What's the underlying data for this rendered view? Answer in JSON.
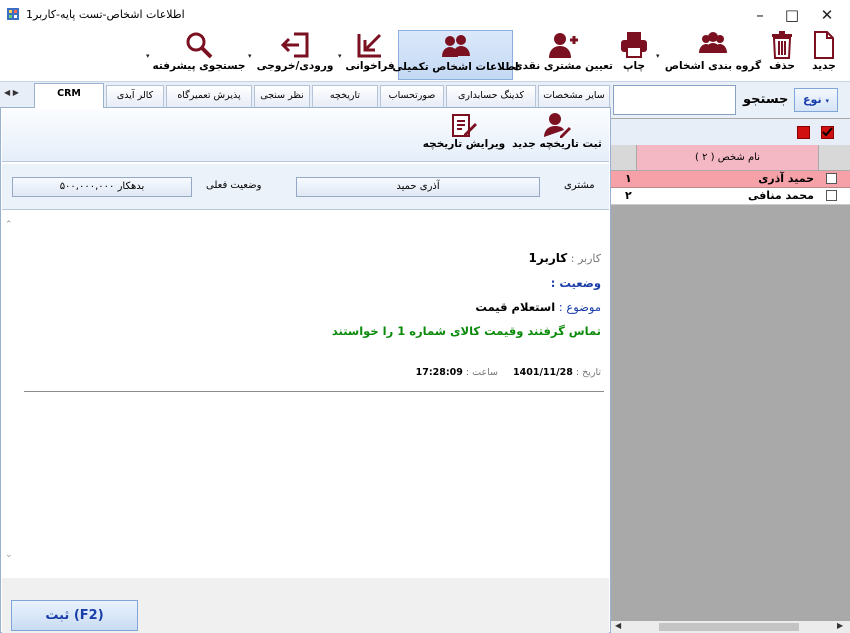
{
  "window": {
    "title": "اطلاعات اشخاص-تست پایه-کاربر1"
  },
  "ribbon": {
    "new_label": "جدید",
    "delete_label": "حذف",
    "group_label": "گروه بندی اشخاص",
    "print_label": "چاپ",
    "assign_customer_label": "تعیین مشتری نقدی",
    "extra_info_label": "اطلاعات اشخاص تکمیلی",
    "recall_label": "فراخوانی",
    "import_export_label": "ورودی/خروجی",
    "advanced_search_label": "جستجوی پیشرفته"
  },
  "tabs": [
    "سایر مشخصات",
    "کدینگ حسابداری",
    "صورتحساب",
    "تاریخچه",
    "نظر سنجی",
    "پذیرش تعمیرگاه",
    "کالر آیدی",
    "CRM"
  ],
  "history_toolbar": {
    "new_label": "ثبت تاریخچه جدید",
    "edit_label": "ویرایش تاریخچه"
  },
  "info": {
    "customer_label": "مشتری",
    "customer_value": "آذری حمید",
    "status_label": "وضعیت فعلی",
    "status_value": "۵۰۰,۰۰۰,۰۰۰  بدهکار"
  },
  "history_entry": {
    "user_label": "کاربر :",
    "user_value": "کاربر1",
    "status_label": "وضعیت :",
    "subject_label": "موضوع :",
    "subject_value": "استعلام قیمت",
    "body": "تماس گرفتند وقیمت کالای شماره 1 را خواستند",
    "date_label": "تاریخ :",
    "date_value": "1401/11/28",
    "time_label": "ساعت :",
    "time_value": "17:28:09"
  },
  "save_button": "ثبت (F2)",
  "search": {
    "label": "جستجو",
    "type_label": "نوع"
  },
  "grid": {
    "header": "نام شخص ( ۲ )",
    "rows": [
      {
        "name": "حمید آذری",
        "num": "۱"
      },
      {
        "name": "محمد منافی",
        "num": "۲"
      }
    ]
  },
  "colors": {
    "selected_row": "#f6a0a8",
    "header_pink": "#f4b8c4",
    "accent_blue": "#1a3ea8",
    "green_text": "#0a8a0a"
  }
}
